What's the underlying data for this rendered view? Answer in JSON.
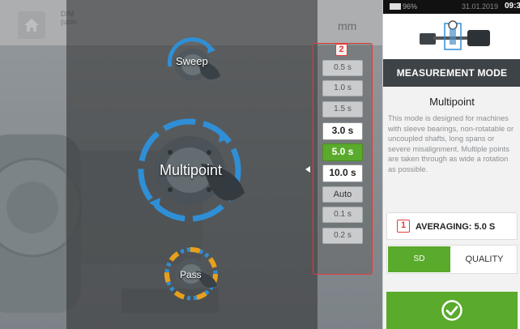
{
  "topbar": {
    "dim_label_1": "DIM",
    "dim_label_2": "(unin",
    "units": "mm"
  },
  "modes": {
    "sweep": "Sweep",
    "multipoint": "Multipoint",
    "pass": "Pass"
  },
  "times": {
    "marker": "2",
    "items": [
      "0.5 s",
      "1.0 s",
      "1.5 s",
      "3.0 s",
      "5.0 s",
      "10.0 s",
      "Auto",
      "0.1 s",
      "0.2 s"
    ],
    "selected": "5.0 s"
  },
  "panel": {
    "status": {
      "battery": "96%",
      "date": "31.01.2019",
      "time": "09:3"
    },
    "header": "MEASUREMENT MODE",
    "mode_title": "Multipoint",
    "mode_description": "This mode is designed for machines with sleeve bearings, non-rotatable or uncoupled shafts, long spans or severe misalignment. Multiple points are taken through as wide a rotation as possible.",
    "averaging_marker": "1",
    "averaging_label": "AVERAGING: 5.0 S",
    "tabs": [
      "SD",
      "QUALITY"
    ],
    "active_tab": "SD"
  },
  "colors": {
    "accent_green": "#5aaa2c",
    "callout_red": "#e23b3b",
    "header_dark": "#3e4347",
    "ring_blue": "#2f8fd6",
    "ring_orange": "#e8a01c"
  },
  "icons": {
    "home": "home-icon",
    "machine": "machine-icon",
    "confirm": "check-circle-icon"
  }
}
